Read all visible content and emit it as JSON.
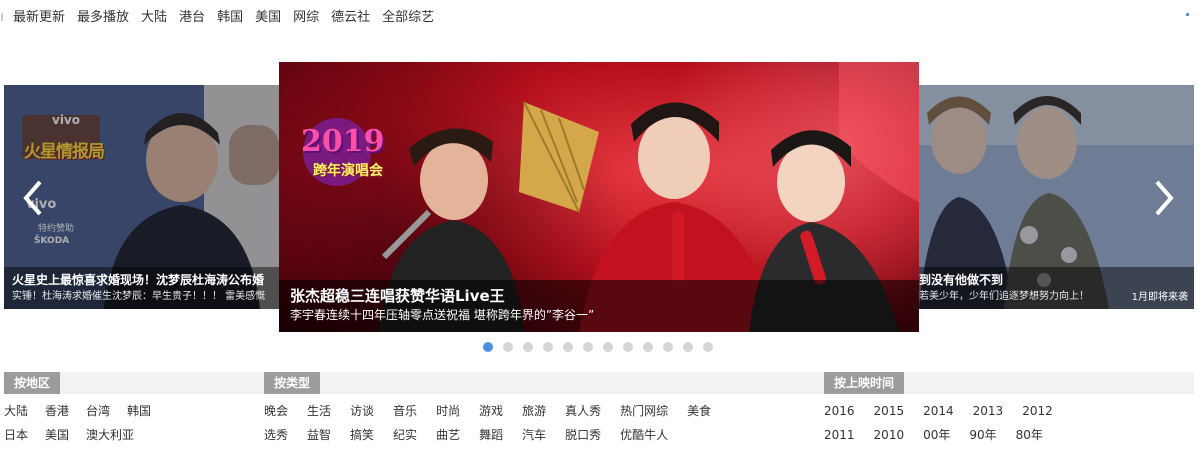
{
  "top_nav": [
    "最新更新",
    "最多播放",
    "大陆",
    "港台",
    "韩国",
    "美国",
    "网综",
    "德云社",
    "全部综艺"
  ],
  "carousel": {
    "main": {
      "title": "张杰超稳三连唱获赞华语Live王",
      "subtitle": "李宇春连续十四年压轴零点送祝福  堪称跨年界的”李谷一”",
      "logo_year": "2019",
      "logo_text": "跨年演唱会"
    },
    "left": {
      "title": "火星史上最惊喜求婚现场！沈梦辰杜海涛公布婚",
      "subtitle": "实锤！杜海涛求婚催生沈梦辰：早生贵子！！！ 雷美感慨",
      "show_name": "火星情报局",
      "sponsor_1": "vivo",
      "sponsor_2": "vivo",
      "sponsor_label": "特约赞助",
      "skoda": "ŠKODA"
    },
    "right": {
      "title": "到没有他做不到",
      "subtitle": "若美少年，少年们追逐梦想努力向上！",
      "corner_note": "1月即将来袭"
    },
    "dot_count": 12,
    "active_dot": 0
  },
  "filters": {
    "region": {
      "title": "按地区",
      "row1": [
        "大陆",
        "香港",
        "台湾",
        "韩国"
      ],
      "row2": [
        "日本",
        "美国",
        "澳大利亚"
      ]
    },
    "type": {
      "title": "按类型",
      "row1": [
        "晚会",
        "生活",
        "访谈",
        "音乐",
        "时尚",
        "游戏",
        "旅游",
        "真人秀",
        "热门网综",
        "美食"
      ],
      "row2": [
        "选秀",
        "益智",
        "搞笑",
        "纪实",
        "曲艺",
        "舞蹈",
        "汽车",
        "脱口秀",
        "优酷牛人"
      ]
    },
    "time": {
      "title": "按上映时间",
      "row1": [
        "2016",
        "2015",
        "2014",
        "2013",
        "2012"
      ],
      "row2": [
        "2011",
        "2010",
        "00年",
        "90年",
        "80年"
      ]
    }
  },
  "colors": {
    "active_dot": "#4a90e2",
    "inactive_dot": "#d5d5d5",
    "filter_title_bg": "#9c9c9c",
    "filter_bar_bg": "#f2f2f2"
  }
}
